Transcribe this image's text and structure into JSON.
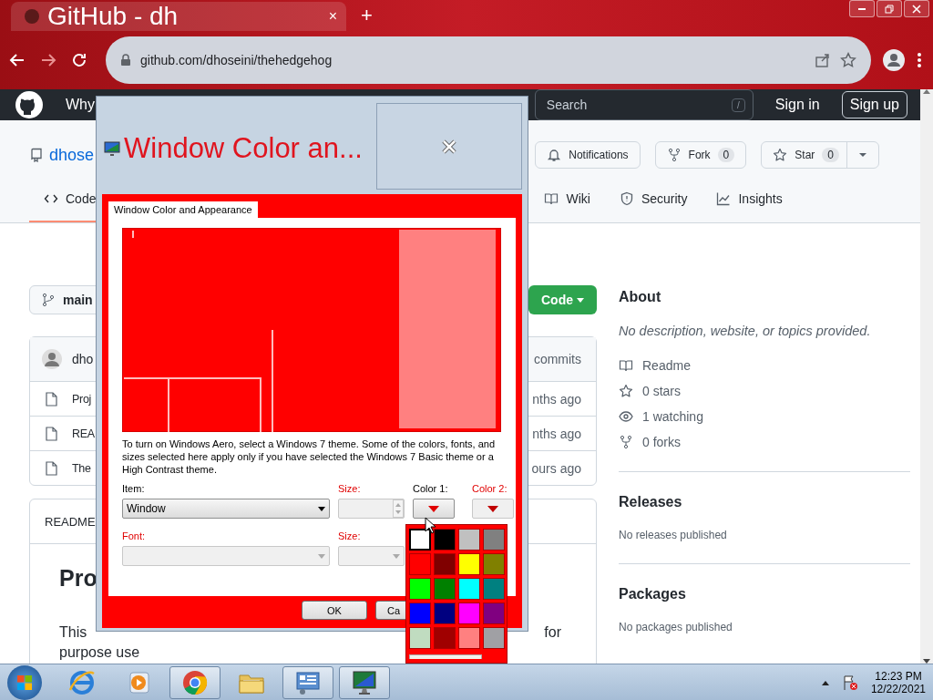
{
  "browser": {
    "tab": {
      "title": "GitHub - dh",
      "close": "×"
    },
    "new_tab": "+",
    "address": "github.com/dhoseini/thehedgehog"
  },
  "github": {
    "header": {
      "nav": "Why",
      "search_placeholder": "Search",
      "search_key": "/",
      "sign_in": "Sign in",
      "sign_up": "Sign up"
    },
    "repo_name": "dhose",
    "actions": [
      {
        "kind": "watch",
        "label": "Notifications"
      },
      {
        "kind": "fork",
        "label": "Fork",
        "count": "0"
      },
      {
        "kind": "star",
        "label": "Star",
        "count": "0"
      }
    ],
    "tabs": [
      {
        "kind": "code",
        "label": "Code",
        "selected": true
      },
      {
        "kind": "wiki",
        "label": "Wiki",
        "selected": false
      },
      {
        "kind": "security",
        "label": "Security",
        "selected": false
      },
      {
        "kind": "insights",
        "label": "Insights",
        "selected": false
      }
    ],
    "branch": "main",
    "code_button": "Code",
    "commit": {
      "author": "dho",
      "commits": "commits"
    },
    "files": [
      {
        "name": "Proj",
        "time": "nths ago"
      },
      {
        "name": "REA",
        "time": "nths ago"
      },
      {
        "name": "The",
        "time": "ours ago"
      }
    ],
    "readme": {
      "header": "README",
      "heading": "Pro",
      "line_start": "This",
      "line_end": "for",
      "line_2": "purpose use"
    },
    "about": {
      "title": "About",
      "description": "No description, website, or topics provided.",
      "stats": [
        {
          "kind": "readme",
          "label": "Readme"
        },
        {
          "kind": "stars",
          "label": "0 stars"
        },
        {
          "kind": "watching",
          "label": "1 watching"
        },
        {
          "kind": "forks",
          "label": "0 forks"
        }
      ]
    },
    "releases": {
      "title": "Releases",
      "note": "No releases published"
    },
    "packages": {
      "title": "Packages",
      "note": "No packages published"
    }
  },
  "dialog": {
    "title": "Window Color an...",
    "tab": "Window Color and Appearance",
    "info": "To turn on Windows Aero, select a Windows 7 theme.  Some of the colors, fonts, and sizes selected here apply only if you have selected the Windows 7 Basic theme or a High Contrast theme.",
    "fields": [
      {
        "kind": "select",
        "label": "Item:",
        "value": "Window",
        "disabled": false
      },
      {
        "kind": "spin",
        "label": "Size:",
        "disabled": true
      },
      {
        "kind": "color",
        "label": "Color 1:",
        "disabled": false
      },
      {
        "kind": "color",
        "label": "Color 2:",
        "disabled": true
      },
      {
        "kind": "select",
        "label": "Font:",
        "disabled": true
      },
      {
        "kind": "select",
        "label": "Size:",
        "disabled": true
      }
    ],
    "buttons": [
      "OK",
      "Ca"
    ],
    "palette": [
      {
        "color": "#ffffff",
        "selected": true
      },
      {
        "color": "#000000",
        "selected": false
      },
      {
        "color": "#c0c0c0",
        "selected": false
      },
      {
        "color": "#808080",
        "selected": false
      },
      {
        "color": "#ff0000",
        "selected": false
      },
      {
        "color": "#800000",
        "selected": false
      },
      {
        "color": "#ffff00",
        "selected": false
      },
      {
        "color": "#808000",
        "selected": false
      },
      {
        "color": "#00ff00",
        "selected": false
      },
      {
        "color": "#008000",
        "selected": false
      },
      {
        "color": "#00ffff",
        "selected": false
      },
      {
        "color": "#008080",
        "selected": false
      },
      {
        "color": "#0000ff",
        "selected": false
      },
      {
        "color": "#000080",
        "selected": false
      },
      {
        "color": "#ff00ff",
        "selected": false
      },
      {
        "color": "#800080",
        "selected": false
      },
      {
        "color": "#c0dcc0",
        "selected": false
      },
      {
        "color": "#a00000",
        "selected": false
      },
      {
        "color": "#ff8080",
        "selected": false
      },
      {
        "color": "#a0a0a4",
        "selected": false
      }
    ]
  },
  "taskbar": {
    "items": [
      {
        "kind": "ie",
        "running": false
      },
      {
        "kind": "media",
        "running": false
      },
      {
        "kind": "chrome",
        "running": true
      },
      {
        "kind": "folder",
        "running": false
      },
      {
        "kind": "control-panel",
        "running": true
      },
      {
        "kind": "display",
        "running": true
      }
    ],
    "time": "12:23 PM",
    "date": "12/22/2021"
  }
}
